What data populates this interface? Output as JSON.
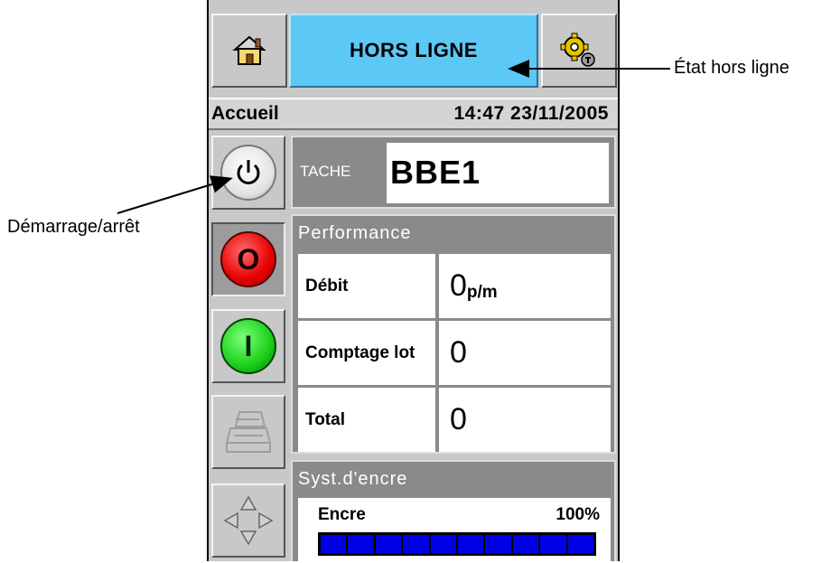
{
  "top_bar": {
    "status": "HORS LIGNE",
    "home_icon": "home-icon",
    "settings_icon": "gear-icon"
  },
  "title_bar": {
    "title": "Accueil",
    "datetime": "14:47 23/11/2005"
  },
  "side_buttons": {
    "stop_label": "O",
    "start_label": "I"
  },
  "job": {
    "label": "TACHE",
    "value": "BBE1"
  },
  "performance": {
    "header": "Performance",
    "rows": [
      {
        "label": "Débit",
        "value": "0",
        "unit": "p/m"
      },
      {
        "label": "Comptage lot",
        "value": "0",
        "unit": ""
      },
      {
        "label": "Total",
        "value": "0",
        "unit": ""
      }
    ]
  },
  "ink": {
    "header": "Syst.d'encre",
    "label": "Encre",
    "percent_text": "100%",
    "level_percent": 100
  },
  "annotations": {
    "offline_state": "État hors ligne",
    "start_stop": "Démarrage/arrêt"
  },
  "colors": {
    "status_bg": "#5cc8f6",
    "stop": "#e60000",
    "start": "#19cf19",
    "ink_bar": "#0000e6"
  }
}
